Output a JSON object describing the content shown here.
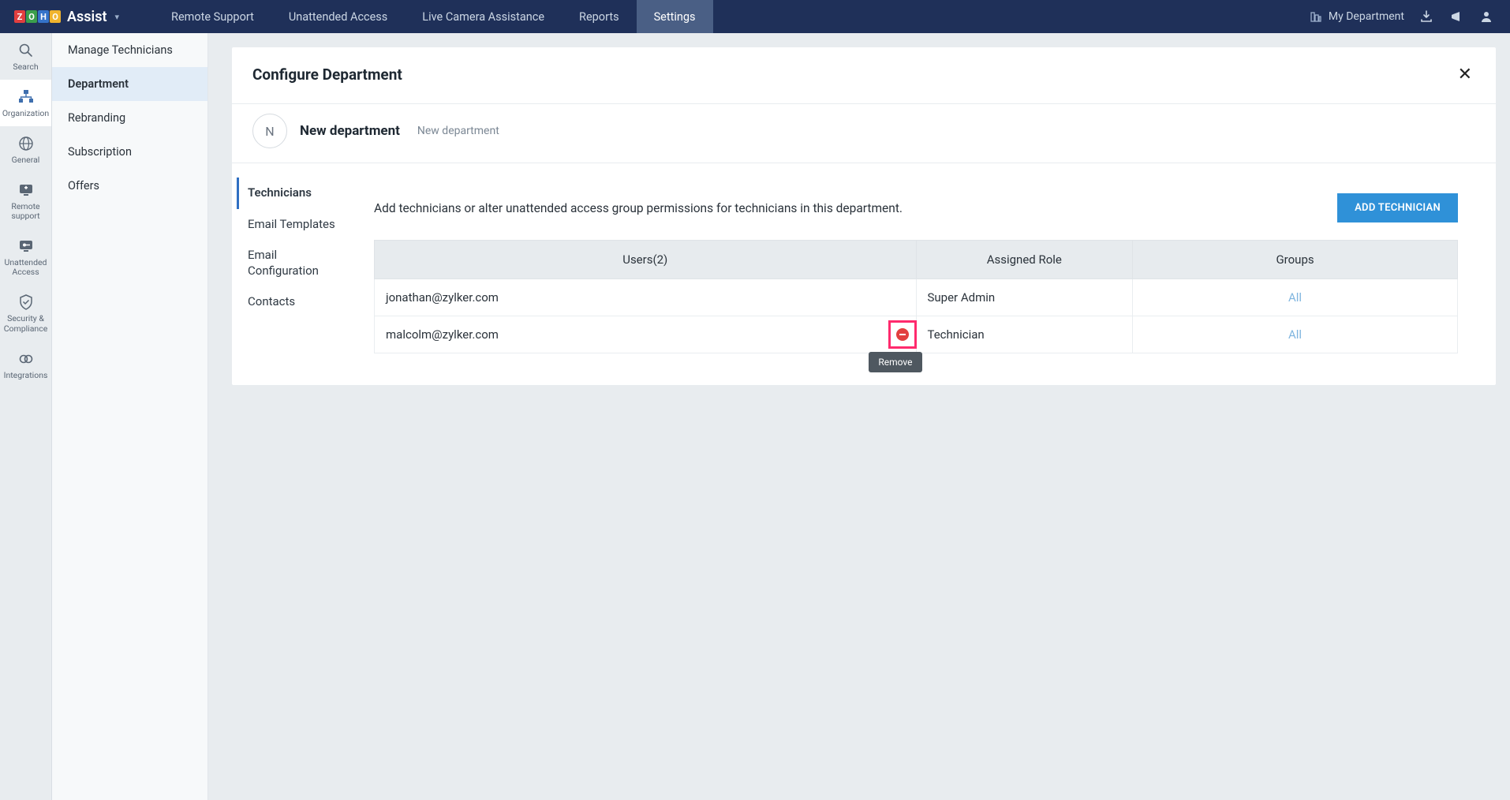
{
  "top": {
    "logo_letters": [
      "Z",
      "O",
      "H",
      "O"
    ],
    "logo_name": "Assist",
    "nav": [
      "Remote Support",
      "Unattended Access",
      "Live Camera Assistance",
      "Reports",
      "Settings"
    ],
    "nav_active": 4,
    "dept": "My Department"
  },
  "rail": [
    {
      "label": "Search",
      "icon": "search"
    },
    {
      "label": "Organization",
      "icon": "org",
      "active": true
    },
    {
      "label": "General",
      "icon": "globe"
    },
    {
      "label": "Remote support",
      "icon": "screen-plus"
    },
    {
      "label": "Unattended Access",
      "icon": "key-screen"
    },
    {
      "label": "Security & Compliance",
      "icon": "shield"
    },
    {
      "label": "Integrations",
      "icon": "link"
    }
  ],
  "sidebar": {
    "items": [
      "Manage Technicians",
      "Department",
      "Rebranding",
      "Subscription",
      "Offers"
    ],
    "active": 1
  },
  "panel": {
    "title": "Configure Department",
    "dept_initial": "N",
    "dept_name": "New department",
    "dept_sub": "New department"
  },
  "tabs": {
    "items": [
      "Technicians",
      "Email Templates",
      "Email Configuration",
      "Contacts"
    ],
    "active": 0
  },
  "content": {
    "desc": "Add technicians or alter unattended access group permissions for technicians in this department.",
    "add_btn": "ADD TECHNICIAN",
    "table": {
      "headers": [
        "Users(2)",
        "Assigned Role",
        "Groups"
      ],
      "rows": [
        {
          "user": "jonathan@zylker.com",
          "role": "Super Admin",
          "groups": "All"
        },
        {
          "user": "malcolm@zylker.com",
          "role": "Technician",
          "groups": "All",
          "hover": true
        }
      ]
    },
    "tooltip": "Remove"
  }
}
